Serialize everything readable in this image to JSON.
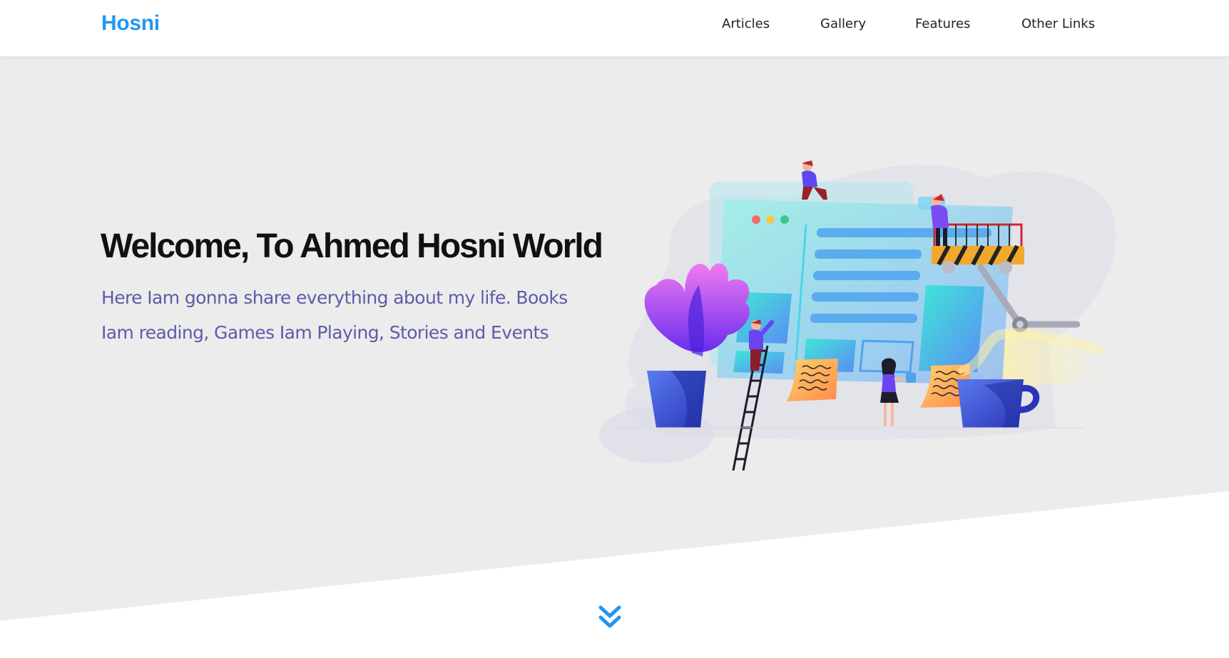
{
  "header": {
    "logo": "Hosni",
    "nav": [
      {
        "label": "Articles"
      },
      {
        "label": "Gallery"
      },
      {
        "label": "Features"
      },
      {
        "label": "Other Links"
      }
    ]
  },
  "hero": {
    "title": "Welcome, To Ahmed Hosni World",
    "description": "Here Iam gonna share everything about my life. Books Iam reading, Games Iam Playing, Stories and Events"
  },
  "colors": {
    "accent": "#2196f3",
    "hero_background": "#ececec",
    "description_text": "#5c5ca8"
  },
  "icons": {
    "scroll_down": "double-chevron-down-icon"
  }
}
